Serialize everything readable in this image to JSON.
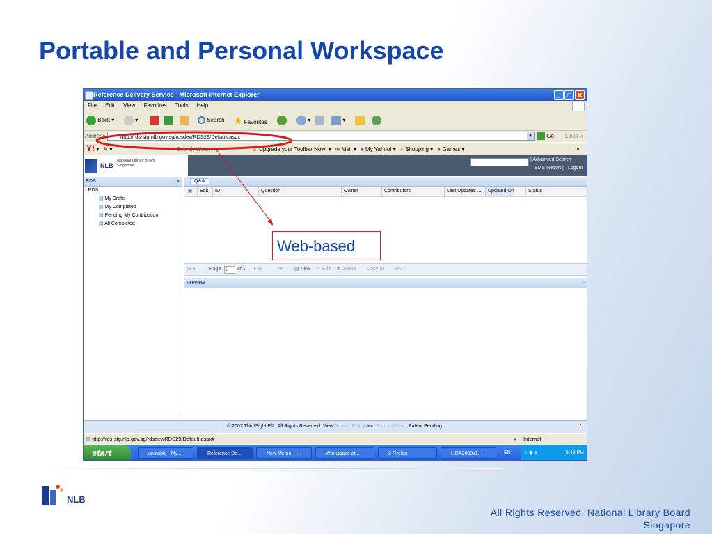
{
  "slide": {
    "title": "Portable and Personal Workspace",
    "callout": "Web-based",
    "rights_line1": "All Rights Reserved. National Library Board",
    "rights_line2": "Singapore",
    "logo_text": "NLB"
  },
  "browser": {
    "window_title": "Reference Delivery Service - Microsoft Internet Explorer",
    "menu": [
      "File",
      "Edit",
      "View",
      "Favorites",
      "Tools",
      "Help"
    ],
    "toolbar": {
      "back": "Back",
      "search": "Search",
      "favorites": "Favorites"
    },
    "address_label": "Address",
    "address": "http://rds-stg.nlb.gov.sg/rdsdev/RDS29/Default.aspx",
    "go": "Go",
    "links": "Links",
    "yahoo_bar": {
      "search_web": "Search Web",
      "upgrade": "Upgrade your Toolbar Now!",
      "mail": "Mail",
      "my_yahoo": "My Yahoo!",
      "shopping": "Shopping",
      "games": "Games"
    }
  },
  "app": {
    "org_name": "National Library Board",
    "org_country": "Singapore",
    "org_abbr": "NLB",
    "advanced_search": "| Advanced Search",
    "ems_report": "EMS Report",
    "logout": "Logout",
    "nav_title": "RDS",
    "tree_root": "RDS",
    "tree_items": [
      "My Drafts",
      "My Completed",
      "Pending My Contribution",
      "All Completed"
    ],
    "tab": "Q&A",
    "grid_columns": [
      "Edit",
      "ID",
      "Question",
      "Owner",
      "Contributors",
      "Last Updated ...",
      "Updated On",
      "Status"
    ],
    "pager": {
      "page_label": "Page",
      "page_value": "1",
      "of": "of 1",
      "new": "New",
      "edit": "Edit",
      "delete": "Delete",
      "copy_id": "Copy ID",
      "rmt": "RMT"
    },
    "preview_title": "Preview",
    "footer": {
      "prefix": "© 2007 ThirdSight P/L. All Rights Reserved. View",
      "privacy": "Privacy Policy",
      "and": "and",
      "terms": "Terms of Use",
      "suffix": ". Patent Pending."
    }
  },
  "status": {
    "url": "http://rds-stg.nlb.gov.sg/rdsdev/RDS29/Default.aspx#",
    "zone": "Internet"
  },
  "taskbar": {
    "start": "start",
    "tasks": [
      "unstable - My...",
      "Reference De...",
      "New Memo - I...",
      "Workspace at...",
      "2 Firefox",
      "LIDA2000v1..."
    ],
    "lang": "EN",
    "time": "5:49 PM"
  }
}
